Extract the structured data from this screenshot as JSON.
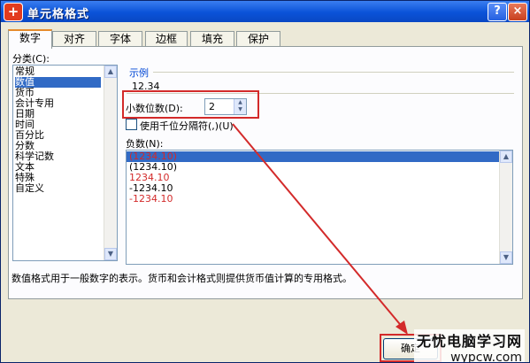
{
  "window": {
    "title": "单元格格式",
    "help_label": "?",
    "close_label": "×",
    "app_icon": "plus-icon"
  },
  "tabs": [
    {
      "label": "数字",
      "active": true
    },
    {
      "label": "对齐"
    },
    {
      "label": "字体"
    },
    {
      "label": "边框"
    },
    {
      "label": "填充"
    },
    {
      "label": "保护"
    }
  ],
  "category": {
    "label": "分类(C):",
    "items": [
      "常规",
      "数值",
      "货币",
      "会计专用",
      "日期",
      "时间",
      "百分比",
      "分数",
      "科学记数",
      "文本",
      "特殊",
      "自定义"
    ],
    "selected": "数值"
  },
  "sample": {
    "label": "示例",
    "value": "12.34"
  },
  "decimal": {
    "label": "小数位数(D):",
    "value": "2"
  },
  "thousands": {
    "label": "使用千位分隔符(,)(U)",
    "checked": false
  },
  "negative": {
    "label": "负数(N):",
    "items": [
      {
        "text": "(1234.10)",
        "color": "#d32a2a",
        "selected": true
      },
      {
        "text": "(1234.10)",
        "color": "#000000"
      },
      {
        "text": "1234.10",
        "color": "#d32a2a"
      },
      {
        "text": "-1234.10",
        "color": "#000000"
      },
      {
        "text": "-1234.10",
        "color": "#d32a2a"
      }
    ]
  },
  "description": "数值格式用于一般数字的表示。货币和会计格式则提供货币值计算的专用格式。",
  "buttons": {
    "ok": "确定"
  },
  "watermark": {
    "line1": "无忧电脑学习网",
    "line2": "wypcw.com"
  },
  "colors": {
    "accent": "#d32a2a",
    "selection": "#316ac5",
    "titlebar": "#0a52d8"
  }
}
